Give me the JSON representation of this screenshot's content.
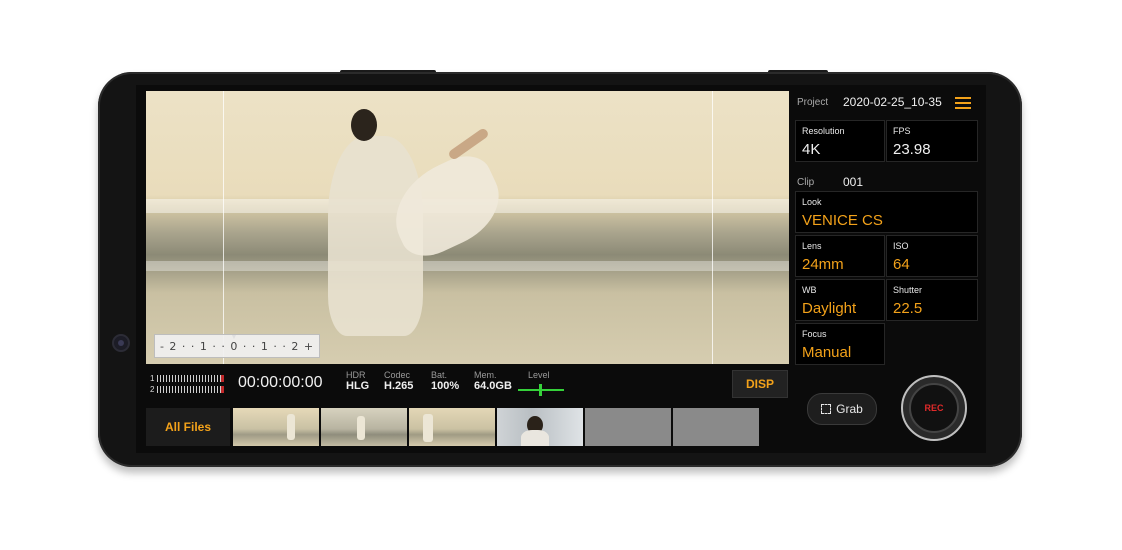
{
  "viewfinder": {
    "level_scale": "- 2 · · 1 · · 0 · · 1 · · 2 +"
  },
  "status": {
    "meter_ch1": "1",
    "meter_ch2": "2",
    "timecode": "00:00:00:00",
    "hdr": {
      "label": "HDR",
      "value": "HLG"
    },
    "codec": {
      "label": "Codec",
      "value": "H.265"
    },
    "battery": {
      "label": "Bat.",
      "value": "100%"
    },
    "memory": {
      "label": "Mem.",
      "value": "64.0GB"
    },
    "level": {
      "label": "Level"
    },
    "disp_button": "DISP"
  },
  "thumbnails": {
    "all_files": "All Files"
  },
  "panel": {
    "project_label": "Project",
    "project_value": "2020-02-25_10-35",
    "resolution": {
      "label": "Resolution",
      "value": "4K"
    },
    "fps": {
      "label": "FPS",
      "value": "23.98"
    },
    "clip_label": "Clip",
    "clip_value": "001",
    "look": {
      "label": "Look",
      "value": "VENICE CS"
    },
    "lens": {
      "label": "Lens",
      "value": "24mm"
    },
    "iso": {
      "label": "ISO",
      "value": "64"
    },
    "wb": {
      "label": "WB",
      "value": "Daylight"
    },
    "shutter": {
      "label": "Shutter",
      "value": "22.5"
    },
    "focus": {
      "label": "Focus",
      "value": "Manual"
    },
    "grab_button": "Grab",
    "rec_button": "REC"
  },
  "colors": {
    "accent": "#f3a21a",
    "rec": "#e02a2a",
    "level_meter": "#35d13a"
  }
}
